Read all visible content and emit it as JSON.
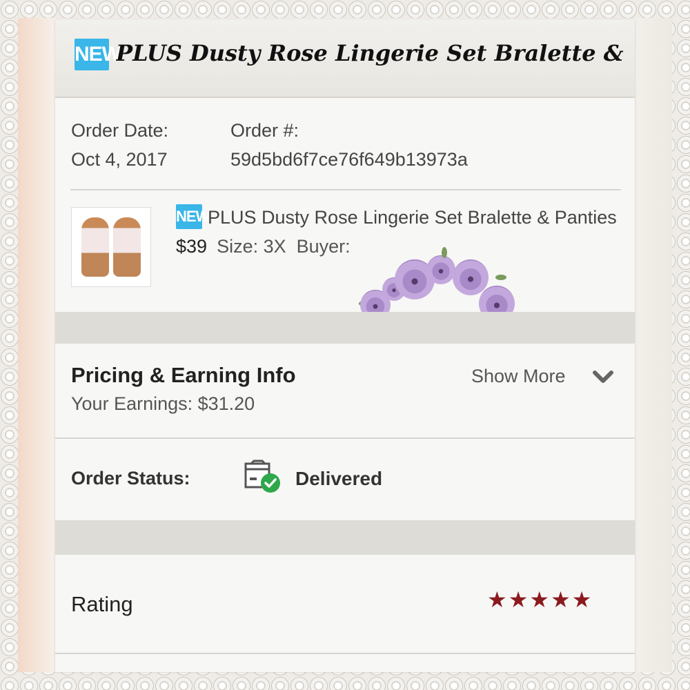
{
  "header": {
    "badge": "NEW",
    "title": "PLUS Dusty Rose Lingerie Set Bralette & ..."
  },
  "order": {
    "date_label": "Order Date:",
    "date_value": "Oct 4, 2017",
    "number_label": "Order #:",
    "number_value": "59d5bd6f7ce76f649b13973a"
  },
  "item": {
    "badge": "NEW",
    "title": "PLUS Dusty Rose Lingerie Set Bralette & Panties",
    "price": "$39",
    "size": "Size: 3X",
    "buyer": "Buyer:"
  },
  "pricing": {
    "title": "Pricing & Earning Info",
    "earnings": "Your Earnings: $31.20",
    "show_more": "Show More"
  },
  "status": {
    "label": "Order Status:",
    "value": "Delivered"
  },
  "rating": {
    "label": "Rating",
    "stars": 5,
    "star_color": "#8b1a1f"
  },
  "colors": {
    "badge": "#3ab6e8",
    "check": "#2ea84a"
  }
}
